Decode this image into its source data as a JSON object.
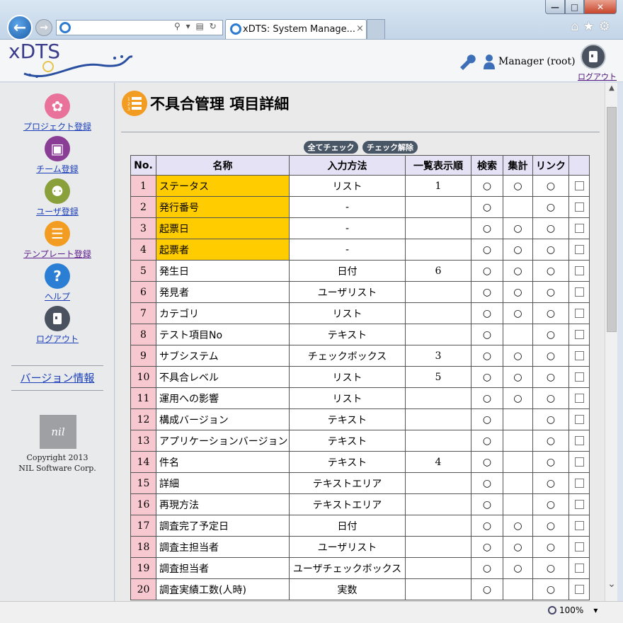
{
  "browser": {
    "tab_title": "xDTS: System Manage...",
    "tab_close": "×"
  },
  "header": {
    "logo_text": "xDTS",
    "user_name": "Manager (root)",
    "logout_label": "ログアウト"
  },
  "sidebar": {
    "items": [
      {
        "label": "プロジェクト登録",
        "icon": "project-icon",
        "color": "#e8729a",
        "visited": false
      },
      {
        "label": "チーム登録",
        "icon": "team-icon",
        "color": "#8a3d94",
        "visited": false
      },
      {
        "label": "ユーザ登録",
        "icon": "users-icon",
        "color": "#8aa03a",
        "visited": false
      },
      {
        "label": "テンプレート登録",
        "icon": "template-icon",
        "color": "#f39c22",
        "visited": true
      },
      {
        "label": "ヘルプ",
        "icon": "help-icon",
        "color": "#2a7fd4",
        "visited": false
      },
      {
        "label": "ログアウト",
        "icon": "logout-icon",
        "color": "#4a5260",
        "visited": false
      }
    ],
    "version_link": "バージョン情報",
    "nil_logo": "nil",
    "copyright_line1": "Copyright 2013",
    "copyright_line2": "NIL Software Corp."
  },
  "main": {
    "page_title": "不具合管理 項目詳細",
    "check_all_label": "全てチェック",
    "uncheck_all_label": "チェック解除",
    "columns": [
      "No.",
      "名称",
      "入力方法",
      "一覧表示順",
      "検索",
      "集計",
      "リンク",
      ""
    ],
    "rows": [
      {
        "no": "1",
        "name": "ステータス",
        "input": "リスト",
        "order": "1",
        "search": "○",
        "agg": "○",
        "link": "○",
        "hl": true
      },
      {
        "no": "2",
        "name": "発行番号",
        "input": "-",
        "order": "",
        "search": "○",
        "agg": "",
        "link": "○",
        "hl": true
      },
      {
        "no": "3",
        "name": "起票日",
        "input": "-",
        "order": "",
        "search": "○",
        "agg": "○",
        "link": "○",
        "hl": true
      },
      {
        "no": "4",
        "name": "起票者",
        "input": "-",
        "order": "",
        "search": "○",
        "agg": "○",
        "link": "○",
        "hl": true
      },
      {
        "no": "5",
        "name": "発生日",
        "input": "日付",
        "order": "6",
        "search": "○",
        "agg": "○",
        "link": "○",
        "hl": false
      },
      {
        "no": "6",
        "name": "発見者",
        "input": "ユーザリスト",
        "order": "",
        "search": "○",
        "agg": "○",
        "link": "○",
        "hl": false
      },
      {
        "no": "7",
        "name": "カテゴリ",
        "input": "リスト",
        "order": "",
        "search": "○",
        "agg": "○",
        "link": "○",
        "hl": false
      },
      {
        "no": "8",
        "name": "テスト項目No",
        "input": "テキスト",
        "order": "",
        "search": "○",
        "agg": "",
        "link": "○",
        "hl": false
      },
      {
        "no": "9",
        "name": "サブシステム",
        "input": "チェックボックス",
        "order": "3",
        "search": "○",
        "agg": "○",
        "link": "○",
        "hl": false
      },
      {
        "no": "10",
        "name": "不具合レベル",
        "input": "リスト",
        "order": "5",
        "search": "○",
        "agg": "○",
        "link": "○",
        "hl": false
      },
      {
        "no": "11",
        "name": "運用への影響",
        "input": "リスト",
        "order": "",
        "search": "○",
        "agg": "○",
        "link": "○",
        "hl": false
      },
      {
        "no": "12",
        "name": "構成バージョン",
        "input": "テキスト",
        "order": "",
        "search": "○",
        "agg": "",
        "link": "○",
        "hl": false
      },
      {
        "no": "13",
        "name": "アプリケーションバージョン",
        "input": "テキスト",
        "order": "",
        "search": "○",
        "agg": "",
        "link": "○",
        "hl": false
      },
      {
        "no": "14",
        "name": "件名",
        "input": "テキスト",
        "order": "4",
        "search": "○",
        "agg": "",
        "link": "○",
        "hl": false
      },
      {
        "no": "15",
        "name": "詳細",
        "input": "テキストエリア",
        "order": "",
        "search": "○",
        "agg": "",
        "link": "○",
        "hl": false
      },
      {
        "no": "16",
        "name": "再現方法",
        "input": "テキストエリア",
        "order": "",
        "search": "○",
        "agg": "",
        "link": "○",
        "hl": false
      },
      {
        "no": "17",
        "name": "調査完了予定日",
        "input": "日付",
        "order": "",
        "search": "○",
        "agg": "○",
        "link": "○",
        "hl": false
      },
      {
        "no": "18",
        "name": "調査主担当者",
        "input": "ユーザリスト",
        "order": "",
        "search": "○",
        "agg": "○",
        "link": "○",
        "hl": false
      },
      {
        "no": "19",
        "name": "調査担当者",
        "input": "ユーザチェックボックス",
        "order": "",
        "search": "○",
        "agg": "○",
        "link": "○",
        "hl": false
      },
      {
        "no": "20",
        "name": "調査実績工数(人時)",
        "input": "実数",
        "order": "",
        "search": "○",
        "agg": "",
        "link": "○",
        "hl": false
      }
    ]
  },
  "statusbar": {
    "zoom": "100%"
  }
}
